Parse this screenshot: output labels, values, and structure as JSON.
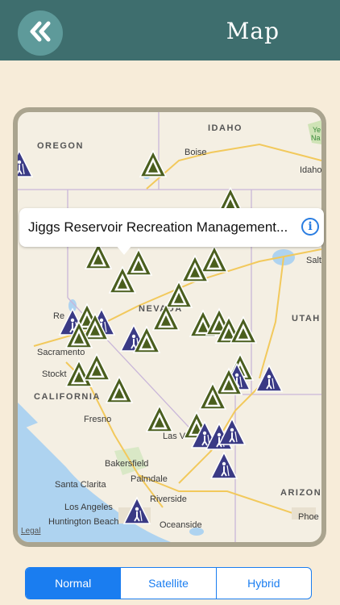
{
  "header": {
    "title": "Map",
    "back_icon": "double-chevron-left-icon",
    "colors": {
      "bar": "#3e6e6e",
      "button": "#5e9a9a"
    }
  },
  "map": {
    "states": [
      "IDAHO",
      "OREGON",
      "NEVADA",
      "UTAH",
      "CALIFORNIA",
      "ARIZONA"
    ],
    "cities": [
      "Boise",
      "Idaho",
      "Salt",
      "Sacramento",
      "Stockt",
      "Fresno",
      "Las V",
      "Bakersfield",
      "Santa Clarita",
      "Palmdale",
      "Riverside",
      "Los Angeles",
      "Huntington Beach",
      "Oceanside",
      "Phoe",
      "Re",
      "Ye",
      "Na"
    ],
    "legal": "Legal",
    "markers": {
      "campground_color": "#4a5e1e",
      "hiking_color": "#3a3a85"
    }
  },
  "callout": {
    "text": "Jiggs Reservoir Recreation Management...",
    "info_icon": "info-icon"
  },
  "map_types": {
    "options": [
      "Normal",
      "Satellite",
      "Hybrid"
    ],
    "selected": "Normal",
    "accent": "#1a7df0"
  }
}
